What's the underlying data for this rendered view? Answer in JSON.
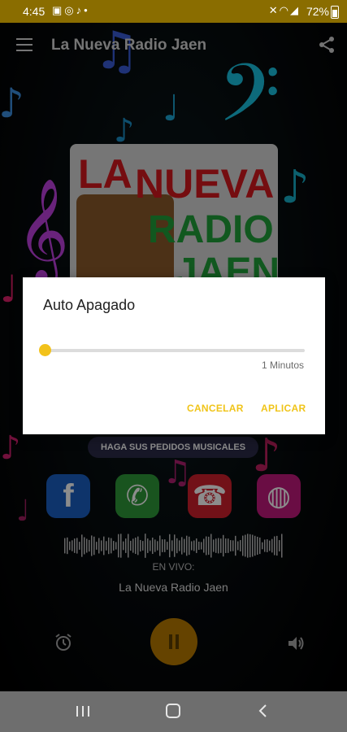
{
  "status_bar": {
    "time": "4:45",
    "left_icons": [
      "image-icon",
      "whatsapp-icon",
      "music-icon",
      "dot-icon"
    ],
    "right_icons": [
      "mute-icon",
      "wifi-icon",
      "signal-icon"
    ],
    "battery": "72%"
  },
  "app_bar": {
    "title": "La Nueva Radio Jaen"
  },
  "logo": {
    "line1": "LA",
    "line2": "NUEVA",
    "line3": "RADIO",
    "line4": "JAEN"
  },
  "pedidos_banner": "HAGA SUS PEDIDOS MUSICALES",
  "social_icons": [
    "facebook-icon",
    "whatsapp-icon",
    "phone-call-icon",
    "web-icon"
  ],
  "player": {
    "live_label": "EN VIVO:",
    "station_name": "La Nueva Radio Jaen"
  },
  "dialog": {
    "title": "Auto Apagado",
    "slider_value": "1 Minutos",
    "slider_fraction": 0.0,
    "cancel_label": "CANCELAR",
    "apply_label": "APLICAR"
  },
  "colors": {
    "accent": "#F2C21B",
    "status_bar": "#8A6D00",
    "play_button": "#B87A00"
  }
}
